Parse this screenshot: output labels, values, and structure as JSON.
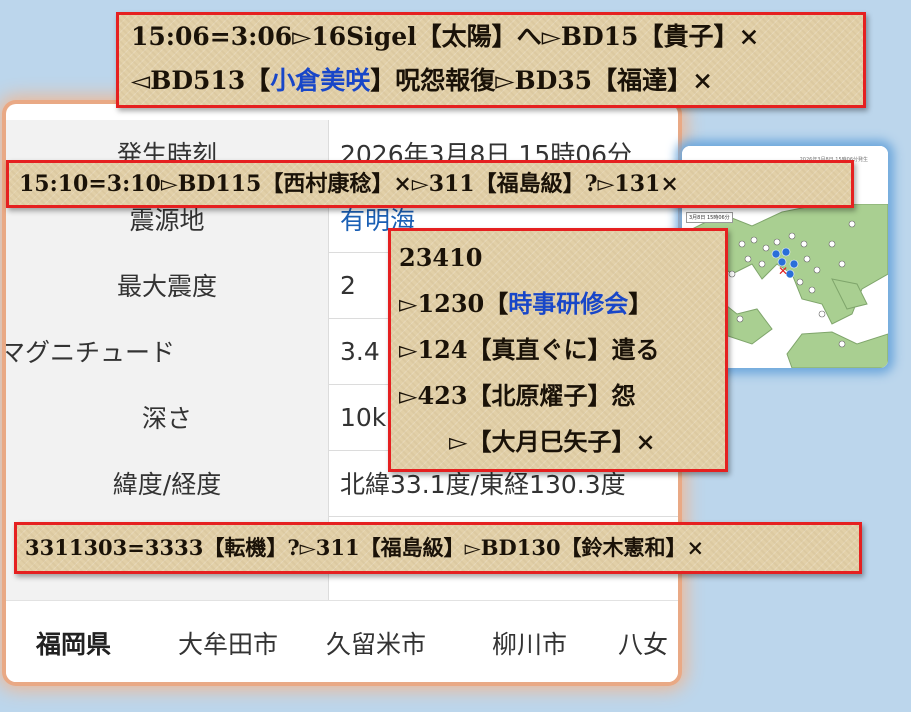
{
  "info": {
    "rows": [
      {
        "label": "発生時刻",
        "value": "2026年3月8日 15時06分"
      },
      {
        "label": "震源地",
        "value": "有明海"
      },
      {
        "label": "最大震度",
        "value": "2"
      },
      {
        "label": "マグニチュード",
        "value": "3.4"
      },
      {
        "label": "深さ",
        "value": "10km"
      },
      {
        "label": "緯度/経度",
        "value": "北緯33.1度/東経130.3度"
      }
    ],
    "prefecture": "福岡県",
    "cities": [
      "大牟田市",
      "久留米市",
      "柳川市",
      "八女"
    ]
  },
  "map": {
    "header_text": "2026年3月8日  15時06分発生",
    "tag": "3月8日 15時06分",
    "intensity_marker": "1",
    "colors": {
      "land": "#a9cf91",
      "sea": "#ffffff",
      "epicenter": "#e02020"
    }
  },
  "notes": {
    "n1": {
      "line1": "15:06=3:06▻16Sigel【太陽】へ▻BD15【貴子】×",
      "line2_pre": "◅BD513【",
      "line2_blue": "小倉美咲",
      "line2_post": "】呪怨報復▻BD35【福達】×"
    },
    "n2": {
      "line1": "15:10=3:10▻BD115【西村康稔】×▻311【福島級】?▻131×"
    },
    "n3": {
      "line1": "23410",
      "line2_pre": "▻1230【",
      "line2_blue": "時事研修会",
      "line2_post": "】",
      "line3": "▻124【真直ぐに】遣る",
      "line4": "▻423【北原燿子】怨",
      "line5": "▻【大月巳矢子】×"
    },
    "n4": {
      "line1": "3311303=3333【転機】?▻311【福島級】▻BD130【鈴木憲和】×"
    }
  }
}
